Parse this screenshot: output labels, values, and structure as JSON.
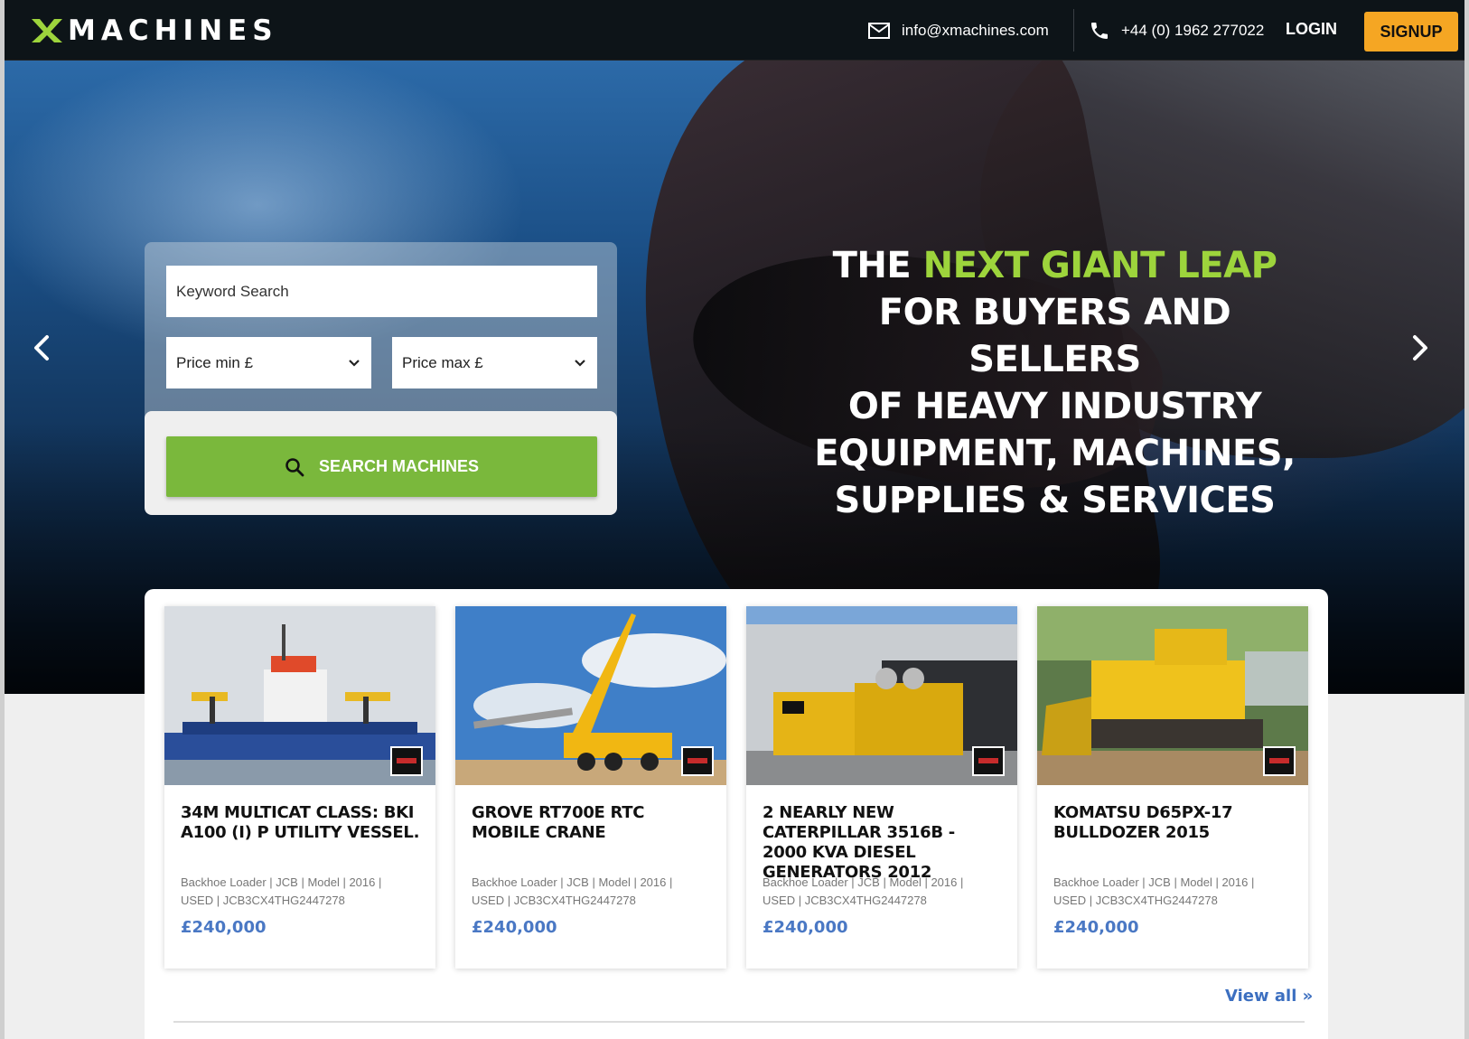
{
  "colors": {
    "accent_green": "#7ab83c",
    "headline_green": "#9dd43c",
    "signup_orange": "#f5a623",
    "price_blue": "#4a78c4",
    "nav_bg": "#0d1418"
  },
  "header": {
    "logo_text": "MACHINES",
    "email": "info@xmachines.com",
    "phone": "+44 (0) 1962 277022",
    "login_label": "LOGIN",
    "signup_label": "SIGNUP"
  },
  "search": {
    "keyword_placeholder": "Keyword Search",
    "price_min_label": "Price min £",
    "price_max_label": "Price max £",
    "button_label": "SEARCH MACHINES"
  },
  "hero": {
    "headline_lead": "THE ",
    "headline_accent": "NEXT GIANT LEAP",
    "headline_line2": "FOR BUYERS AND SELLERS",
    "headline_line3": "OF HEAVY INDUSTRY",
    "headline_line4": "EQUIPMENT, MACHINES,",
    "headline_line5": "SUPPLIES & SERVICES"
  },
  "listings": [
    {
      "title": "34M MULTICAT CLASS: BKI A100 (I) P UTILITY VESSEL.",
      "meta_line1": "Backhoe Loader | JCB | Model | 2016 |",
      "meta_line2": "USED | JCB3CX4THG2447278",
      "price": "£240,000"
    },
    {
      "title": "GROVE RT700E RTC MOBILE CRANE",
      "meta_line1": "Backhoe Loader | JCB | Model | 2016 |",
      "meta_line2": "USED | JCB3CX4THG2447278",
      "price": "£240,000"
    },
    {
      "title": "2 NEARLY NEW CATERPILLAR 3516B - 2000 KVA DIESEL GENERATORS 2012",
      "meta_line1": "Backhoe Loader | JCB | Model | 2016 |",
      "meta_line2": "USED | JCB3CX4THG2447278",
      "price": "£240,000"
    },
    {
      "title": "KOMATSU D65PX-17 BULLDOZER 2015",
      "meta_line1": "Backhoe Loader | JCB | Model | 2016 |",
      "meta_line2": "USED | JCB3CX4THG2447278",
      "price": "£240,000"
    }
  ],
  "view_all_label": "View all »"
}
